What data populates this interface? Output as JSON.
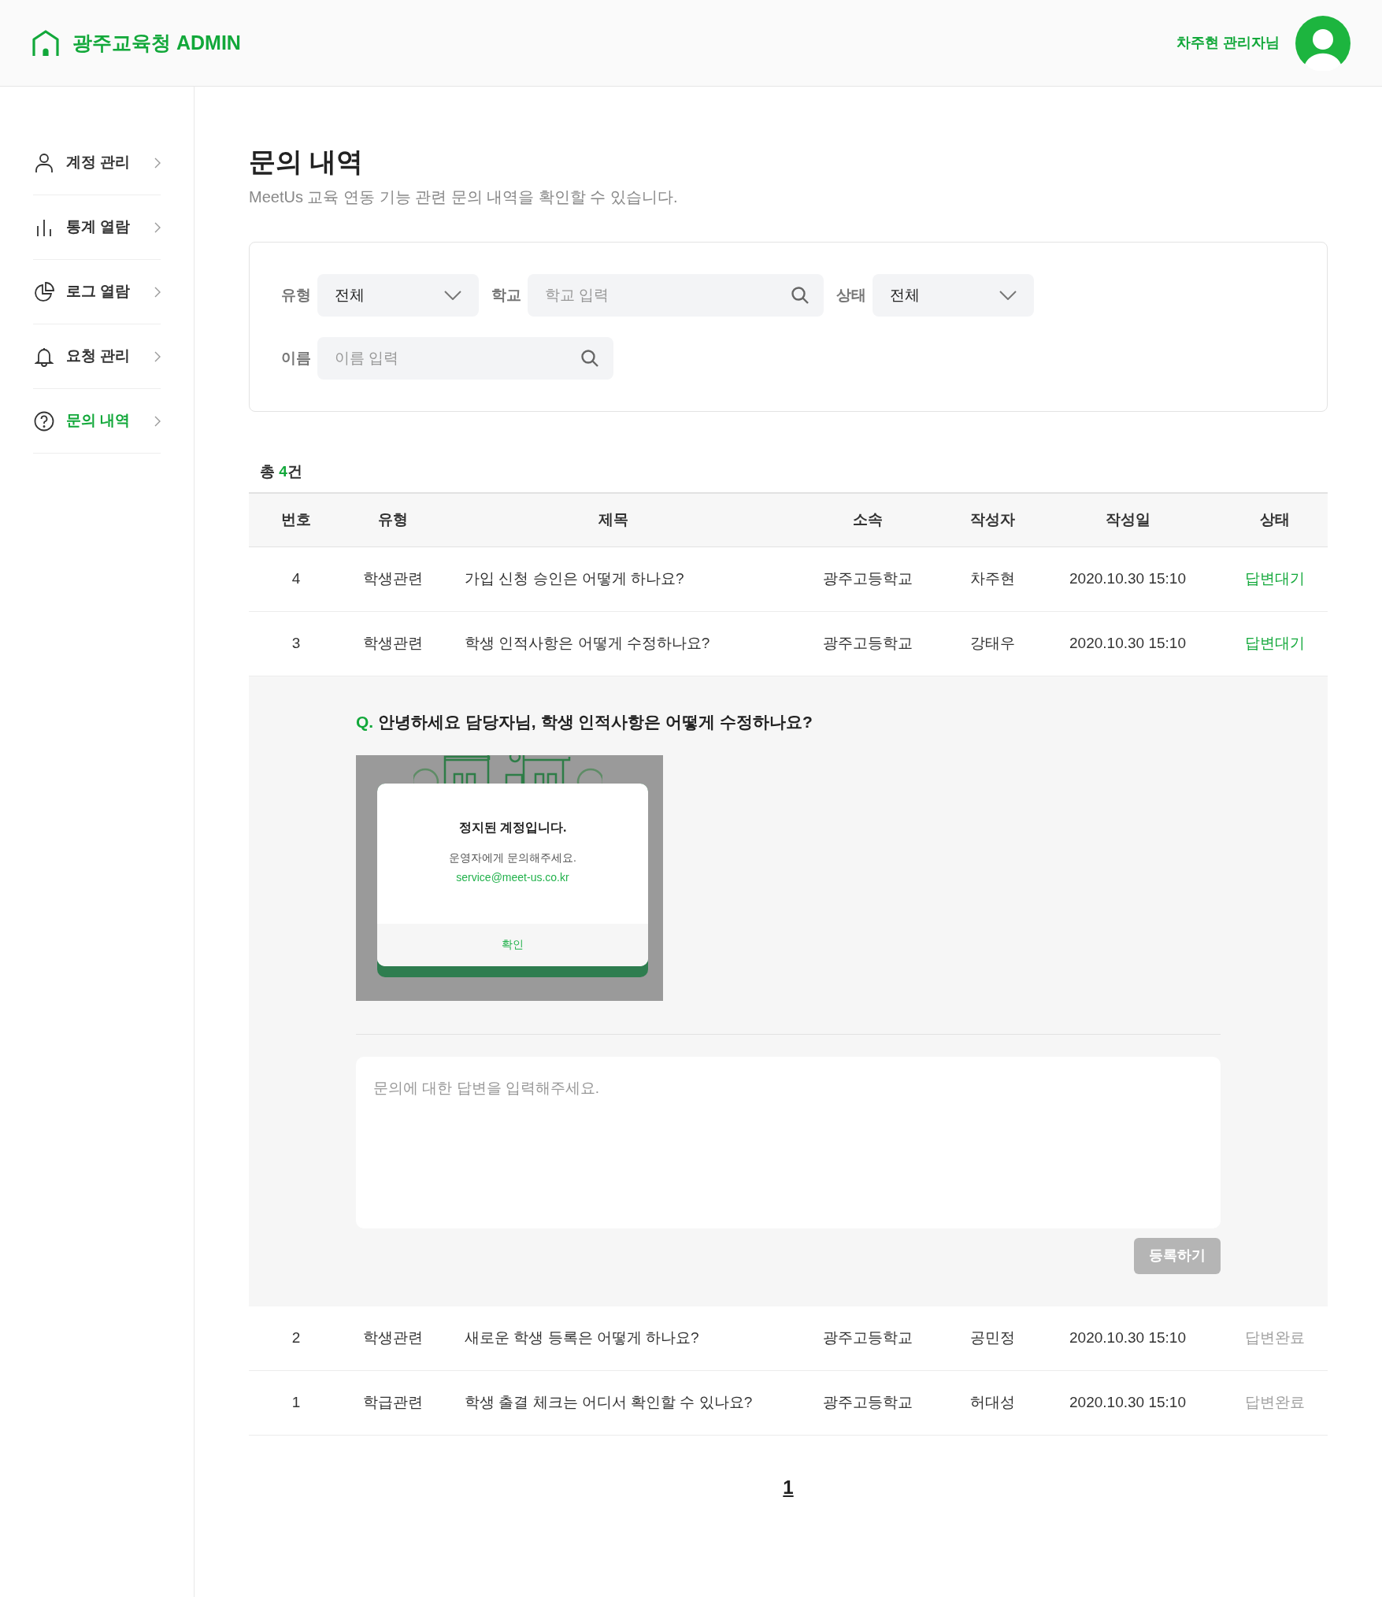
{
  "header": {
    "logo_text": "광주교육청 ADMIN",
    "user_label": "차주현 관리자님"
  },
  "sidebar": {
    "items": [
      {
        "label": "계정 관리",
        "kind": "person",
        "selected": false
      },
      {
        "label": "통계 열람",
        "kind": "bars",
        "selected": false
      },
      {
        "label": "로그 열람",
        "kind": "pie",
        "selected": false
      },
      {
        "label": "요청 관리",
        "kind": "bell",
        "selected": false
      },
      {
        "label": "문의 내역",
        "kind": "question",
        "selected": true
      }
    ]
  },
  "page": {
    "title": "문의 내역",
    "subtitle": "MeetUs 교육 연동 기능 관련 문의 내역을 확인할 수 있습니다."
  },
  "filters": {
    "type": {
      "label": "유형",
      "value": "전체"
    },
    "school": {
      "label": "학교",
      "placeholder": "학교 입력"
    },
    "status": {
      "label": "상태",
      "value": "전체"
    },
    "name": {
      "label": "이름",
      "placeholder": "이름 입력"
    }
  },
  "total": {
    "prefix": "총 ",
    "count": "4",
    "suffix": "건"
  },
  "table": {
    "columns": [
      "번호",
      "유형",
      "제목",
      "소속",
      "작성자",
      "작성일",
      "상태"
    ],
    "rows": [
      {
        "number": "4",
        "type": "학생관련",
        "title": "가입 신청 승인은 어떻게 하나요?",
        "org": "광주고등학교",
        "author": "차주현",
        "date": "2020.10.30 15:10",
        "status": "답변대기",
        "answered": false
      },
      {
        "number": "3",
        "type": "학생관련",
        "title": "학생 인적사항은 어떻게 수정하나요?",
        "org": "광주고등학교",
        "author": "강태우",
        "date": "2020.10.30 15:10",
        "status": "답변대기",
        "answered": false,
        "detail": {
          "q_mark": "Q.",
          "question": "안녕하세요 담당자님, 학생 인적사항은 어떻게 수정하나요?",
          "attachment": {
            "title": "정지된 계정입니다.",
            "message": "운영자에게 문의해주세요.",
            "email": "service@meet-us.co.kr",
            "button": "확인"
          },
          "answer_placeholder": "문의에 대한 답변을 입력해주세요.",
          "submit": "등록하기"
        }
      },
      {
        "number": "2",
        "type": "학생관련",
        "title": "새로운 학생 등록은 어떻게 하나요?",
        "org": "광주고등학교",
        "author": "공민정",
        "date": "2020.10.30 15:10",
        "status": "답변완료",
        "answered": true
      },
      {
        "number": "1",
        "type": "학급관련",
        "title": "학생 출결 체크는 어디서 확인할 수 있나요?",
        "org": "광주고등학교",
        "author": "허대성",
        "date": "2020.10.30 15:10",
        "status": "답변완료",
        "answered": true
      }
    ]
  },
  "pagination": [
    {
      "label": "1",
      "selected": true
    }
  ]
}
